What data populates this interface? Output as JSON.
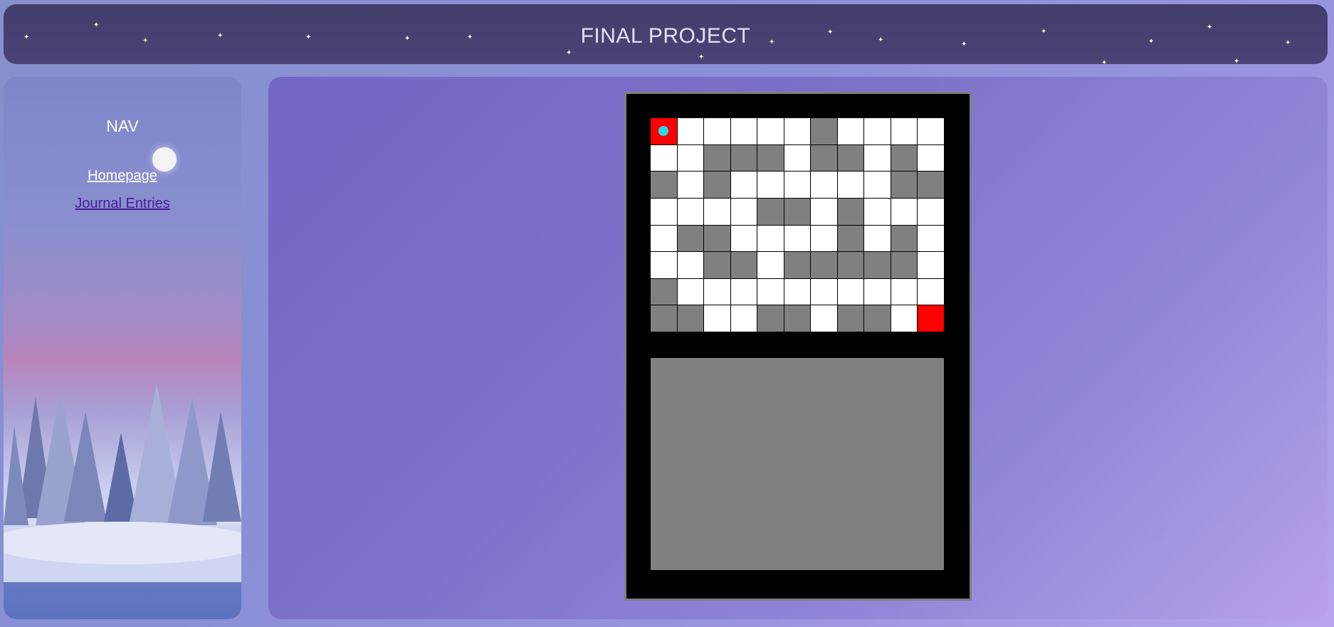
{
  "header": {
    "title": "FINAL PROJECT"
  },
  "sidebar": {
    "nav_title": "NAV",
    "links": [
      {
        "label": "Homepage"
      },
      {
        "label": "Journal Entries"
      }
    ]
  },
  "game": {
    "rows": 8,
    "cols": 11,
    "legend": {
      "0": "path",
      "1": "wall",
      "2": "start",
      "3": "goal"
    },
    "grid": [
      [
        2,
        0,
        0,
        0,
        0,
        0,
        1,
        0,
        0,
        0,
        0
      ],
      [
        0,
        0,
        1,
        1,
        1,
        0,
        1,
        1,
        0,
        1,
        0
      ],
      [
        1,
        0,
        1,
        0,
        0,
        0,
        0,
        0,
        0,
        1,
        1
      ],
      [
        0,
        0,
        0,
        0,
        1,
        1,
        0,
        1,
        0,
        0,
        0
      ],
      [
        0,
        1,
        1,
        0,
        0,
        0,
        0,
        1,
        0,
        1,
        0
      ],
      [
        0,
        0,
        1,
        1,
        0,
        1,
        1,
        1,
        1,
        1,
        0
      ],
      [
        1,
        0,
        0,
        0,
        0,
        0,
        0,
        0,
        0,
        0,
        0
      ],
      [
        1,
        1,
        0,
        0,
        1,
        1,
        0,
        1,
        1,
        0,
        3
      ]
    ],
    "player": {
      "row": 0,
      "col": 0
    },
    "colors": {
      "path": "#ffffff",
      "wall": "#808080",
      "start": "#ff0000",
      "goal": "#ff0000",
      "player": "#29d9e9",
      "frame": "#000000",
      "panel": "#808080"
    }
  }
}
